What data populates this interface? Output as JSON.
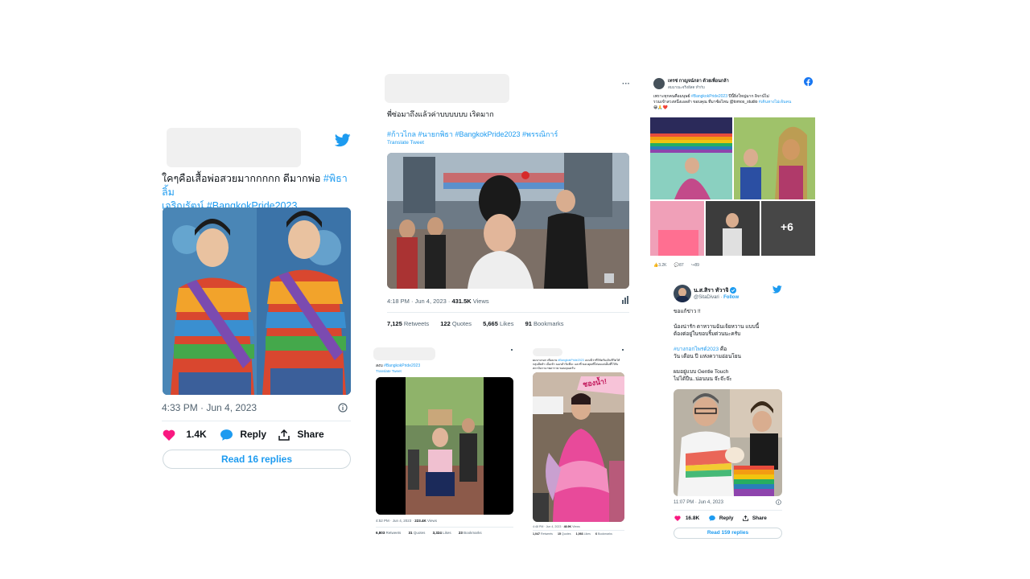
{
  "card1": {
    "text_main": "ใคๆคือเสื้อพ่อสวยมากกกกก ดีมากพ่อ ",
    "hashtag1": "#พิธาลิ้ม",
    "line2_hashtag1": "เจริญรัตน์",
    "line2_hashtag2": " #BangkokPride2023",
    "timestamp": "4:33 PM · Jun 4, 2023",
    "likes": "1.4K",
    "reply_label": "Reply",
    "share_label": "Share",
    "read_replies": "Read 16 replies",
    "colors": {
      "heart": "#f91880",
      "accent": "#1d9bf0"
    }
  },
  "card2": {
    "text_main": "พี่ซ่อมาถึงแล้วค่าบบบบบบ เริดมาก",
    "hashtags": "#ก้าวไกล  #นายกพิธา #BangkokPride2023 #พรรณิการ์",
    "translate": "Translate Tweet",
    "more": "···",
    "timestamp": "4:18 PM · Jun 4, 2023 · ",
    "views_count": "431.5K",
    "views_label": " Views",
    "retweets_count": "7,125",
    "retweets_label": " Retweets",
    "quotes_count": "122",
    "quotes_label": " Quotes",
    "likes_count": "5,665",
    "likes_label": " Likes",
    "bookmarks_count": "91",
    "bookmarks_label": " Bookmarks"
  },
  "card3": {
    "page_name": "เทรซ่ กาญจน์ภลา ด้วยเพื่อนกล้า",
    "sub": "สมมาณะจริงอีสด ทำกับ",
    "text1": "เพราะทุกคนคือมนุษย์ ",
    "hashtag": "#BangkokPride2023",
    "text2": " ปีนี้ยิ่งใหญ่มาก อิจาน์ไม่",
    "text3": "รวมเข้าสวงหนึ่งเอลลำ ขอบคุณ ที่มาซ้อไหน @tomos_studio ",
    "hashtag2": "#เคินทางไม่เจ้นคน",
    "emojis": "😀🙏❤️",
    "more_photos": "+6",
    "reactions": "3.2K",
    "comments": "87",
    "shares": "89"
  },
  "card4": {
    "name": "น.ส.สิรา ทัวาจิ",
    "handle": "@SitaDivari",
    "follow": "Follow",
    "line1": "ขอแก้ข่าว !!",
    "line2": "น้องน่ารัก ดาหวานฉันเจ้ยหวาน แบบนี้",
    "line3": "ต้องต่อยู่ในขอบริ้มด่วนนะครับ",
    "hashtag": "#บางกอกไพรด์2023",
    "line4_suffix": " คือ",
    "line5": "วัน เดือน ปี แห่งความอ่อนโยน",
    "line6": "ผมอยู่แบบ Gentle Touch",
    "line7": "ไม่ได้ปีน..น่อนนน จ๊ะจ๊ะจ๊ะ",
    "timestamp": "11:07 PM · Jun 4, 2023",
    "likes": "16.8K",
    "reply_label": "Reply",
    "share_label": "Share",
    "read_replies": "Read 159 replies"
  },
  "card5": {
    "text": "สงบ ",
    "hashtag": "#BangkokPride2023",
    "translate": "Translate Tweet",
    "timestamp": "4:52 PM · Jun 4, 2023 · ",
    "views": "223.4K",
    "views_label": " Views",
    "retweets": "6,803",
    "retweets_label": " Retweets",
    "quotes": "31",
    "quotes_label": " Quotes",
    "likes": "3,324",
    "likes_label": " Likes",
    "bookmarks": "23",
    "bookmarks_label": " Bookmarks"
  },
  "card6": {
    "text": "ผมบางกอก เพื่อนาย ",
    "hashtag": "#BangkokPride2023",
    "text2": " แบบนี้ว่าที่ใช้ครับเดินชีวิตให้กลุ่มอีสลำ",
    "text3": "เมื่อเช้า นอกคำวันที่จะ และที่ ขอบคุณที่ใส่อบแต่เต็มที่ไว้กับสถาบันรามาพลาราษ ขอบคุณครับ",
    "sign": "ชองน้ำ!",
    "timestamp": "4:48 PM · Jun 4, 2023 · ",
    "views": "48.9K",
    "views_label": " Views",
    "retweets": "1,047",
    "retweets_label": " Retweets",
    "quotes": "15",
    "quotes_label": " Quotes",
    "likes": "1,066",
    "likes_label": " Likes",
    "bookmarks": "6",
    "bookmarks_label": " Bookmarks"
  }
}
